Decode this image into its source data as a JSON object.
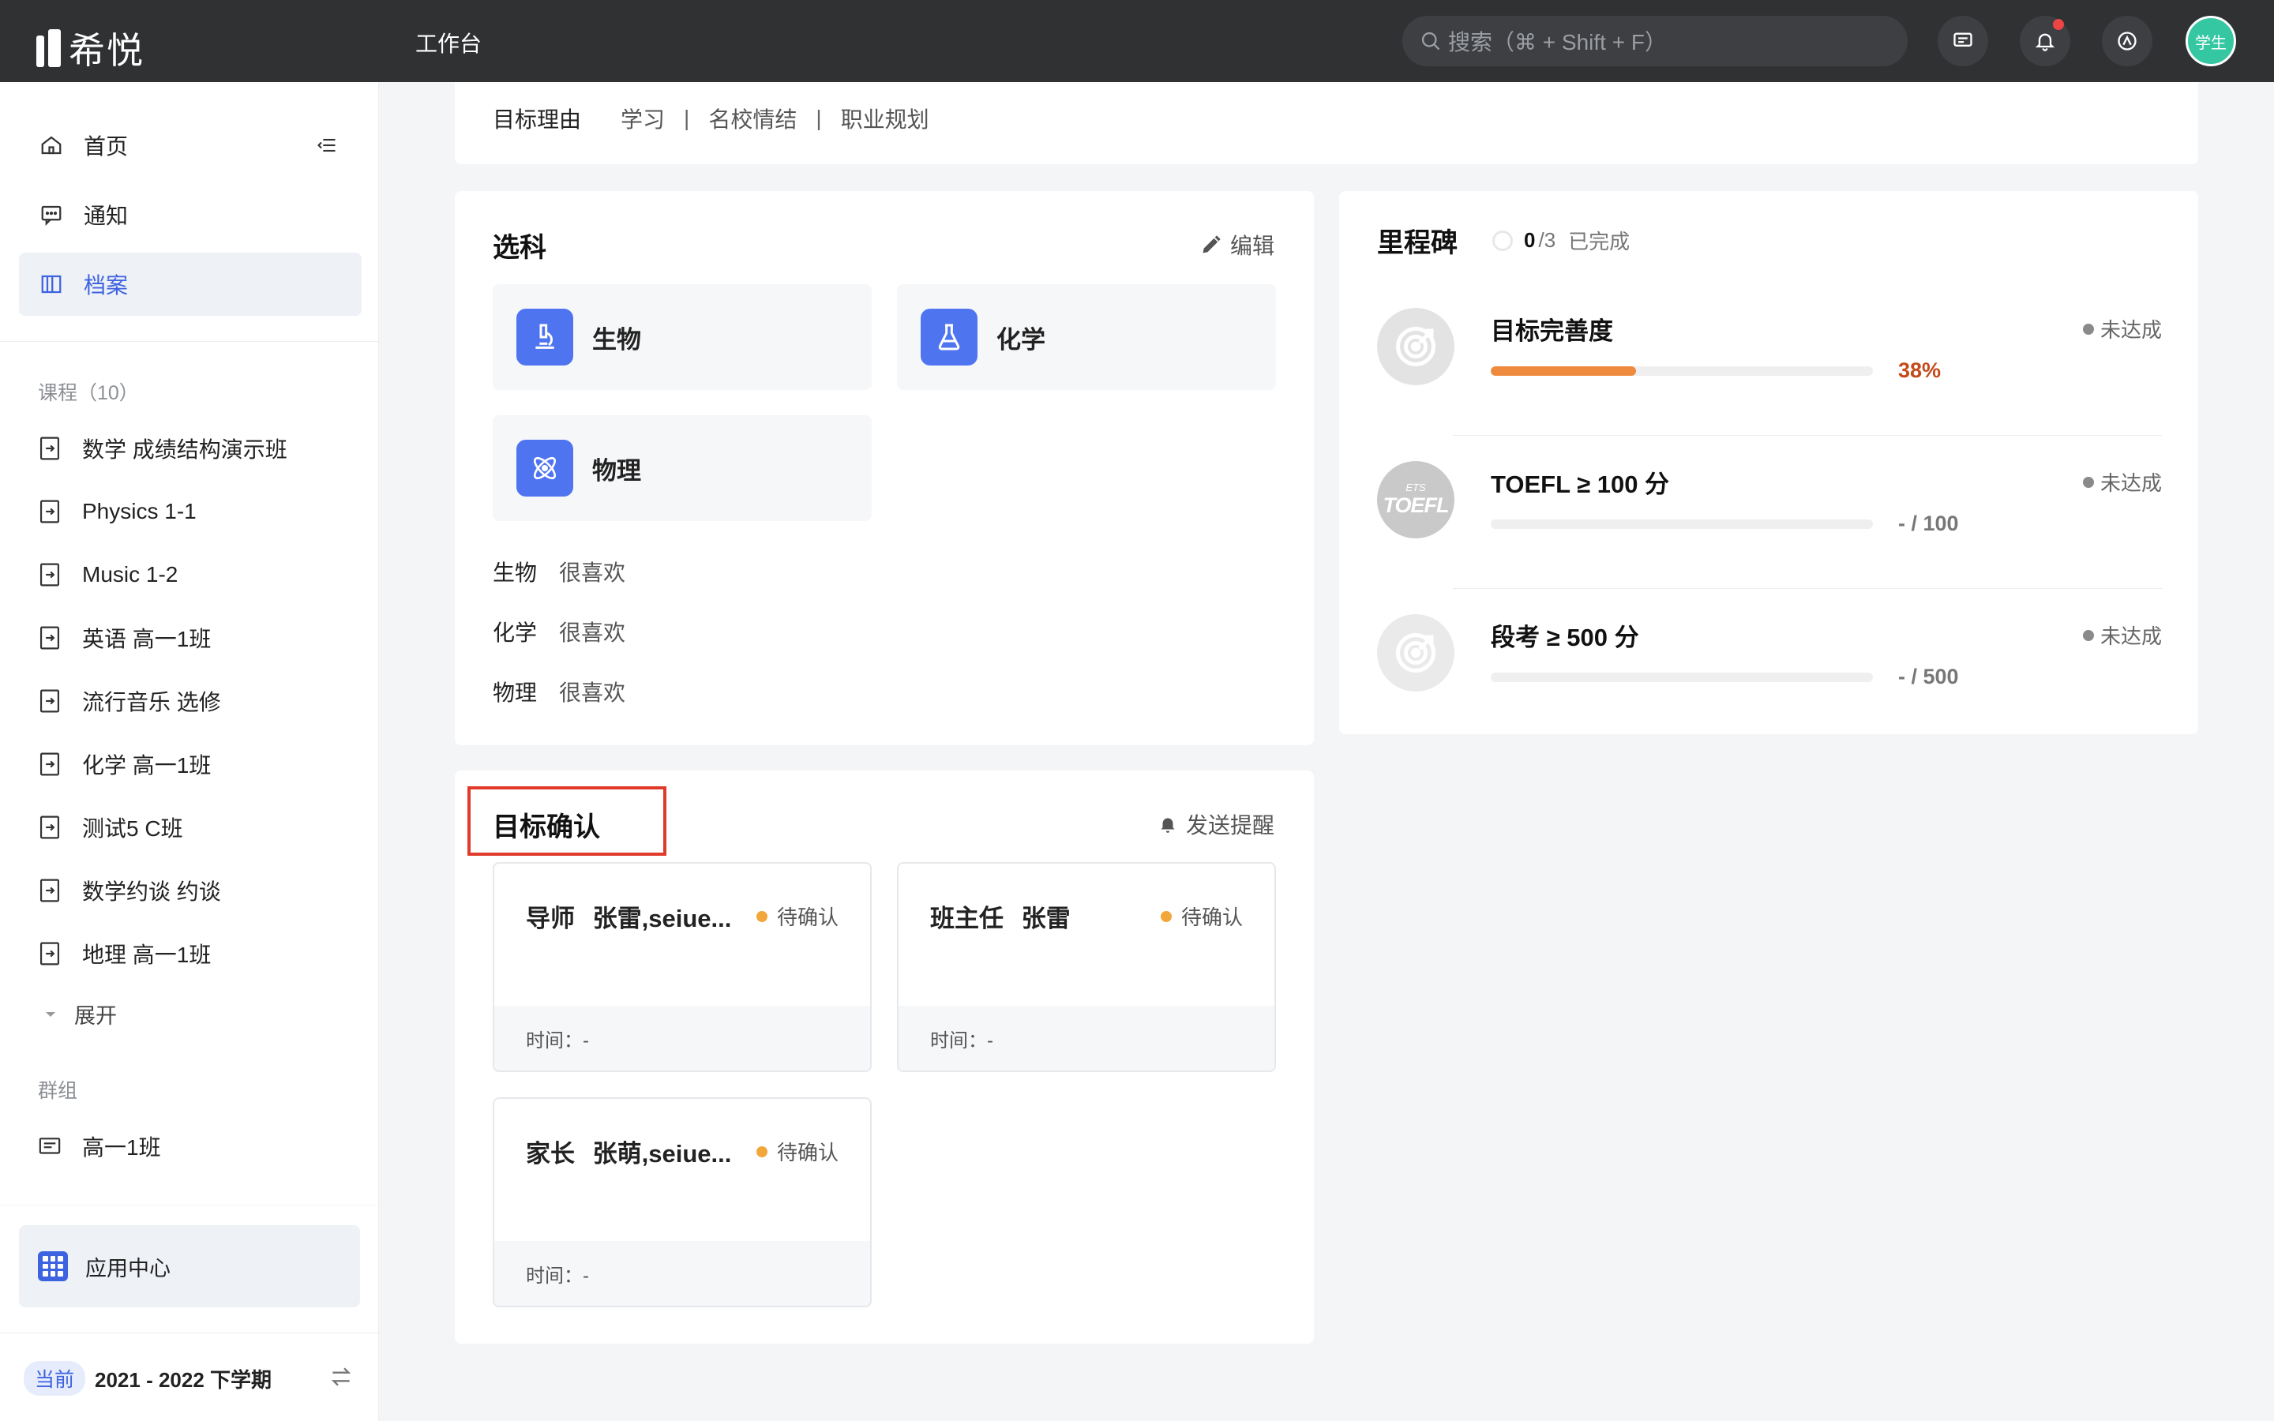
{
  "topbar": {
    "logo_text": "希悦",
    "title": "工作台",
    "search_placeholder": "搜索（⌘ + Shift + F）",
    "avatar_label": "学生"
  },
  "sidebar": {
    "nav": [
      {
        "label": "首页",
        "icon": "home-icon"
      },
      {
        "label": "通知",
        "icon": "message-icon"
      },
      {
        "label": "档案",
        "icon": "archive-icon",
        "active": true
      }
    ],
    "courses_label": "课程（10）",
    "courses": [
      "数学 成绩结构演示班",
      "Physics 1-1",
      "Music 1-2",
      "英语 高一1班",
      "流行音乐 选修",
      "化学 高一1班",
      "测试5 C班",
      "数学约谈 约谈",
      "地理 高一1班"
    ],
    "expand_label": "展开",
    "groups_label": "群组",
    "groups": [
      "高一1班"
    ],
    "app_center": "应用中心",
    "semester_pill": "当前",
    "semester": "2021 - 2022 下学期"
  },
  "reason": {
    "label": "目标理由",
    "tags": [
      "学习",
      "名校情结",
      "职业规划"
    ],
    "separator": "|"
  },
  "subjects": {
    "title": "选科",
    "edit": "编辑",
    "tiles": [
      {
        "name": "生物",
        "icon": "microscope-icon"
      },
      {
        "name": "化学",
        "icon": "flask-icon"
      },
      {
        "name": "物理",
        "icon": "atom-icon"
      }
    ],
    "preferences": [
      {
        "subject": "生物",
        "value": "很喜欢"
      },
      {
        "subject": "化学",
        "value": "很喜欢"
      },
      {
        "subject": "物理",
        "value": "很喜欢"
      }
    ]
  },
  "confirm": {
    "title": "目标确认",
    "send_reminder": "发送提醒",
    "items": [
      {
        "role": "导师",
        "names": "张雷,seiue...",
        "status": "待确认",
        "time": "时间：-"
      },
      {
        "role": "班主任",
        "names": "张雷",
        "status": "待确认",
        "time": "时间：-"
      },
      {
        "role": "家长",
        "names": "张萌,seiue...",
        "status": "待确认",
        "time": "时间：-"
      }
    ],
    "status_color": "#f2a73a"
  },
  "milestones": {
    "title": "里程碑",
    "done": "0",
    "total": "/3",
    "done_label": "已完成",
    "items": [
      {
        "title": "目标完善度",
        "status": "未达成",
        "value": "38%",
        "progress": 0.38,
        "icon": "target-icon"
      },
      {
        "title": "TOEFL ≥ 100 分",
        "status": "未达成",
        "value": "- / 100",
        "progress": 0,
        "icon": "toefl-logo",
        "logo_text": "TOEFL",
        "logo_sub": "ETS"
      },
      {
        "title": "段考 ≥ 500 分",
        "status": "未达成",
        "value": "- / 500",
        "progress": 0,
        "icon": "target-icon"
      }
    ]
  },
  "colors": {
    "accent": "#3d63e0",
    "progress": "#ee8a3d",
    "highlight_box": "#e03a2a"
  }
}
